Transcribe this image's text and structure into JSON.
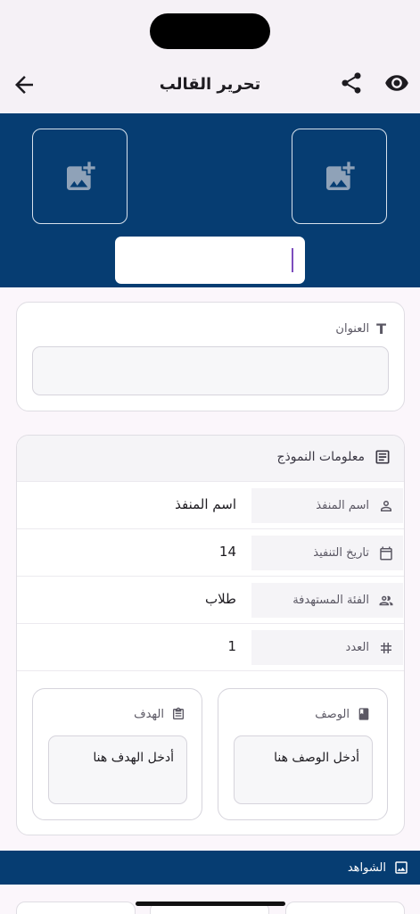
{
  "app_bar": {
    "title": "تحرير القالب",
    "icons": [
      "arrow-back-icon",
      "share-icon",
      "eye-icon"
    ]
  },
  "banner": {
    "image_slots": [
      "add-photo-icon",
      "add-photo-icon"
    ],
    "title_input_value": ""
  },
  "title_card": {
    "label": "العنوان",
    "input_value": ""
  },
  "info_card": {
    "header": "معلومات النموذج",
    "rows": [
      {
        "key": "اسم المنفذ",
        "value": "اسم المنفذ",
        "icon": "person-icon"
      },
      {
        "key": "تاريخ التنفيذ",
        "value": "14",
        "icon": "calendar-icon"
      },
      {
        "key": "الفئة المستهدفة",
        "value": "طلاب",
        "icon": "group-icon"
      },
      {
        "key": "العدد",
        "value": "1",
        "icon": "hash-icon"
      }
    ],
    "description": {
      "label": "الوصف",
      "placeholder": "أدخل الوصف هنا",
      "icon": "book-icon"
    },
    "goal": {
      "label": "الهدف",
      "placeholder": "أدخل الهدف هنا",
      "icon": "clipboard-icon"
    }
  },
  "evidence": {
    "label": "الشواهد",
    "icon": "image-icon"
  },
  "colors": {
    "primary": "#063d72",
    "accent": "#7c4dbd",
    "background": "#fbf6fb"
  }
}
